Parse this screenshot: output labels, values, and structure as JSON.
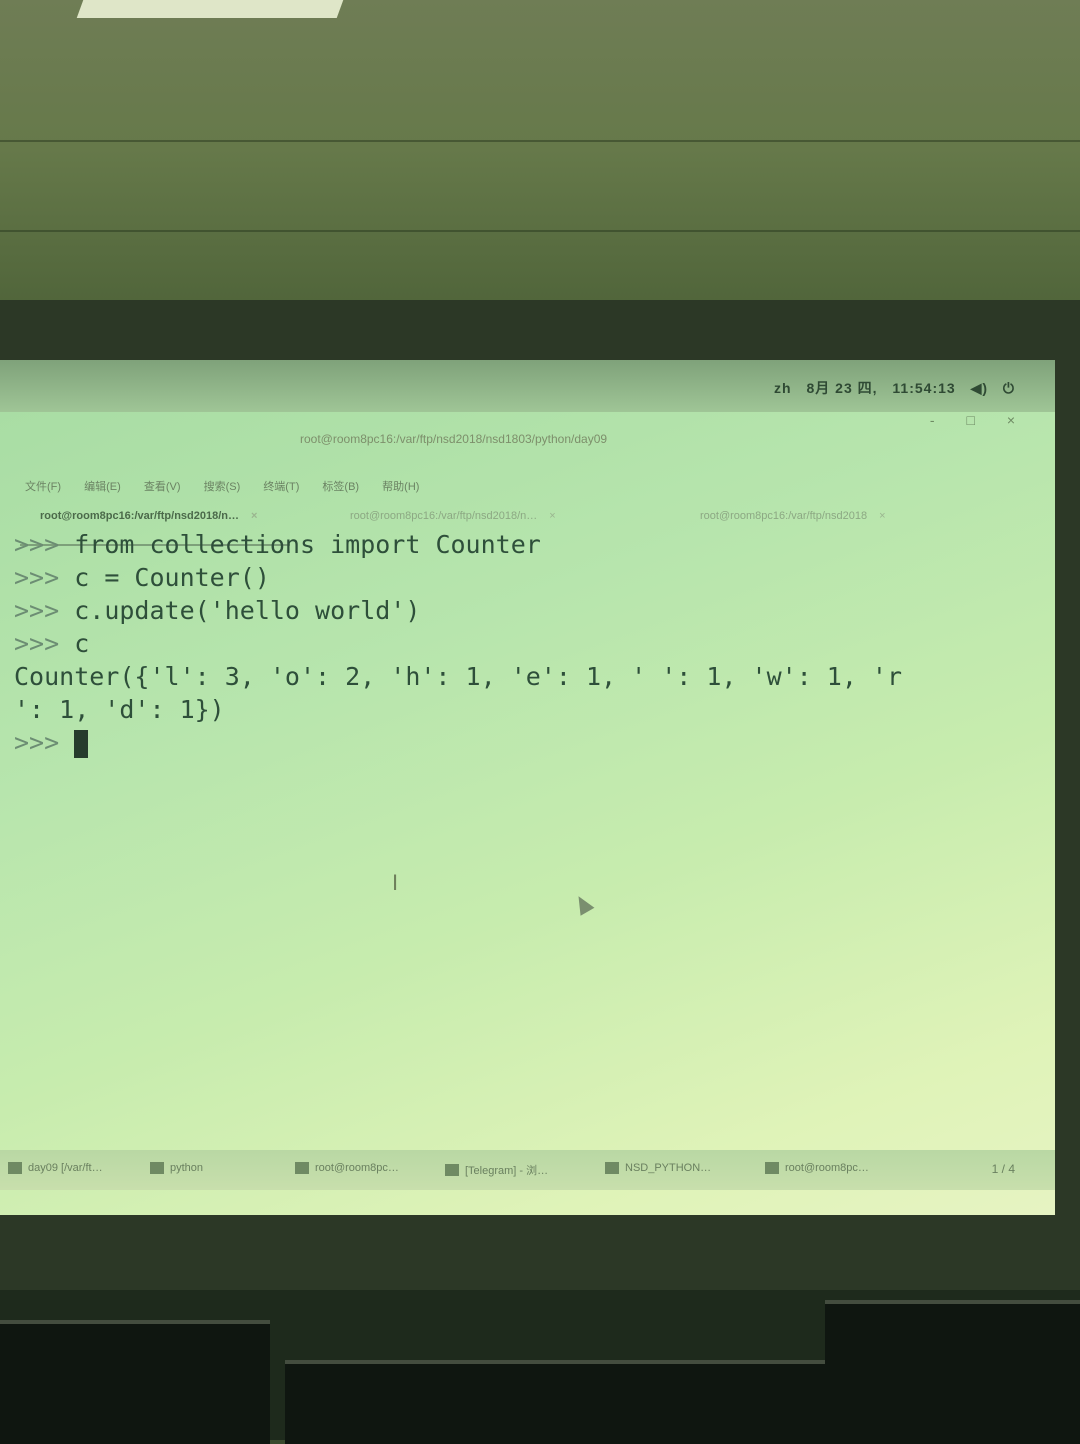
{
  "topbar": {
    "input_method": "zh",
    "date": "8月 23 四,",
    "time": "11:54:13"
  },
  "window": {
    "title": "root@room8pc16:/var/ftp/nsd2018/nsd1803/python/day09",
    "controls": [
      "-",
      "□",
      "×"
    ]
  },
  "menubar": {
    "items": [
      "文件(F)",
      "编辑(E)",
      "查看(V)",
      "搜索(S)",
      "终端(T)",
      "标签(B)",
      "帮助(H)"
    ]
  },
  "tabs": [
    {
      "label": "root@room8pc16:/var/ftp/nsd2018/n…",
      "active": true
    },
    {
      "label": "root@room8pc16:/var/ftp/nsd2018/n…",
      "active": false
    },
    {
      "label": "root@room8pc16:/var/ftp/nsd2018",
      "active": false
    }
  ],
  "terminal": {
    "lines": [
      {
        "prompt": ">>> ",
        "text": "from collections import Counter"
      },
      {
        "prompt": ">>> ",
        "text": "c = Counter()"
      },
      {
        "prompt": ">>> ",
        "text": "c.update('hello world')"
      },
      {
        "prompt": ">>> ",
        "text": "c"
      },
      {
        "prompt": "",
        "text": "Counter({'l': 3, 'o': 2, 'h': 1, 'e': 1, ' ': 1, 'w': 1, 'r"
      },
      {
        "prompt": "",
        "text": "': 1, 'd': 1})"
      },
      {
        "prompt": ">>> ",
        "text": ""
      }
    ]
  },
  "taskbar": {
    "items": [
      "day09 [/var/ft…",
      "python",
      "root@room8pc…",
      "[Telegram] - 浏…",
      "NSD_PYTHON…",
      "root@room8pc…"
    ],
    "pager": "1 / 4"
  }
}
